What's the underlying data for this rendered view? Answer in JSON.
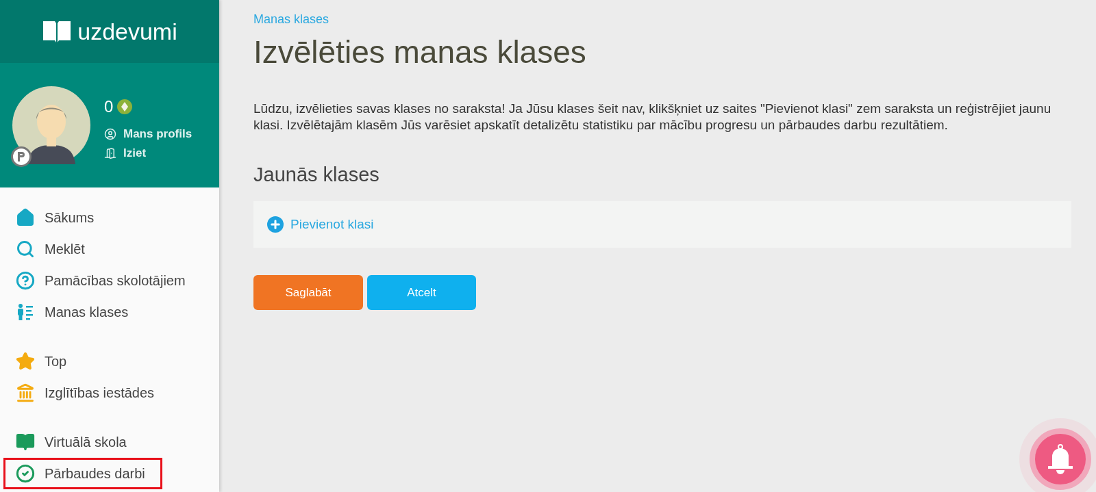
{
  "logo": {
    "text": "uzdevumi"
  },
  "profile": {
    "points": "0",
    "links": [
      {
        "kind": "profile",
        "label": "Mans profils"
      },
      {
        "kind": "logout",
        "label": "Iziet"
      }
    ]
  },
  "nav_groups": [
    [
      {
        "kind": "home",
        "label": "Sākums",
        "highlighted": false
      },
      {
        "kind": "search",
        "label": "Meklēt",
        "highlighted": false
      },
      {
        "kind": "help",
        "label": "Pamācības skolotājiem",
        "highlighted": false
      },
      {
        "kind": "classes",
        "label": "Manas klases",
        "highlighted": false
      }
    ],
    [
      {
        "kind": "star",
        "label": "Top",
        "highlighted": false
      },
      {
        "kind": "institution",
        "label": "Izglītības iestādes",
        "highlighted": false
      }
    ],
    [
      {
        "kind": "book",
        "label": "Virtuālā skola",
        "highlighted": false
      },
      {
        "kind": "check",
        "label": "Pārbaudes darbi",
        "highlighted": true
      }
    ]
  ],
  "breadcrumb": "Manas klases",
  "title": "Izvēlēties manas klases",
  "description": "Lūdzu, izvēlieties savas klases no saraksta! Ja Jūsu klases šeit nav, klikšķniet uz saites \"Pievienot klasi\" zem saraksta un reģistrējiet jaunu klasi. Izvēlētajām klasēm Jūs varēsiet apskatīt detalizētu statistiku par mācību progresu un pārbaudes darbu rezultātiem.",
  "section_title": "Jaunās klases",
  "add_link": "Pievienot klasi",
  "buttons": [
    {
      "kind": "primary",
      "label": "Saglabāt"
    },
    {
      "kind": "secondary",
      "label": "Atcelt"
    }
  ]
}
